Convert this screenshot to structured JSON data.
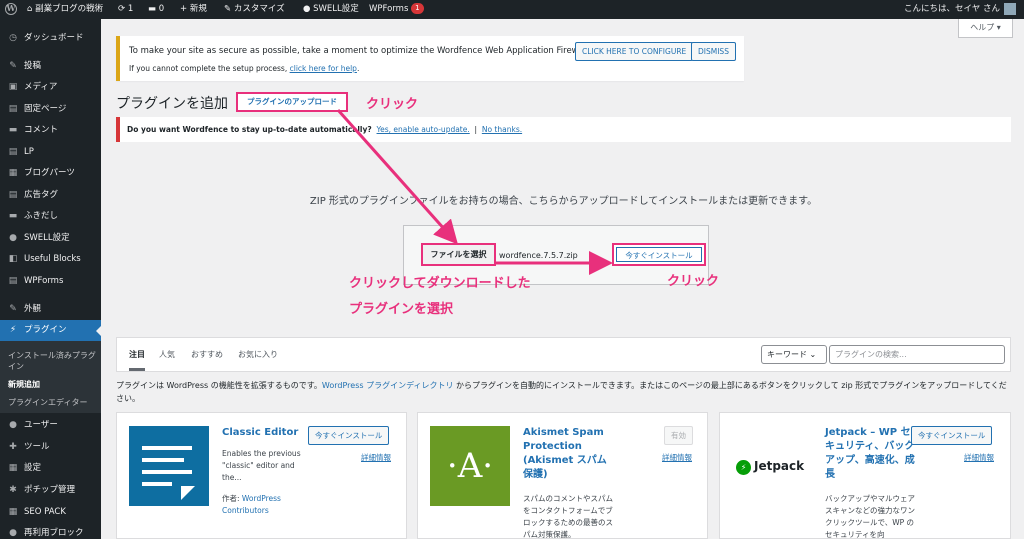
{
  "adminbar": {
    "site": "副業ブログの戦術",
    "updates": "1",
    "comments": "0",
    "new": "新規",
    "customize": "カスタマイズ",
    "swell": "SWELL設定",
    "wpforms": "WPForms",
    "wpforms_badge": "1",
    "howdy": "こんにちは、セイヤ さん"
  },
  "help_label": "ヘルプ ▾",
  "sidebar": {
    "items": [
      {
        "label": "ダッシュボード",
        "icon": "dashboard-icon",
        "glyph": "◷"
      },
      {
        "label": "投稿",
        "icon": "pin-icon",
        "glyph": "✎"
      },
      {
        "label": "メディア",
        "icon": "media-icon",
        "glyph": "▣"
      },
      {
        "label": "固定ページ",
        "icon": "page-icon",
        "glyph": "▤"
      },
      {
        "label": "コメント",
        "icon": "comment-icon",
        "glyph": "▬"
      },
      {
        "label": "LP",
        "icon": "lp-icon",
        "glyph": "▤"
      },
      {
        "label": "ブログパーツ",
        "icon": "parts-icon",
        "glyph": "▦"
      },
      {
        "label": "広告タグ",
        "icon": "ad-icon",
        "glyph": "▤"
      },
      {
        "label": "ふきだし",
        "icon": "balloon-icon",
        "glyph": "▬"
      },
      {
        "label": "SWELL設定",
        "icon": "swell-icon",
        "glyph": "●"
      },
      {
        "label": "Useful Blocks",
        "icon": "blocks-icon",
        "glyph": "◧"
      },
      {
        "label": "WPForms",
        "icon": "forms-icon",
        "glyph": "▤"
      },
      {
        "label": "外観",
        "icon": "brush-icon",
        "glyph": "✎"
      },
      {
        "label": "プラグイン",
        "icon": "plugin-icon",
        "glyph": "⚡"
      },
      {
        "label": "ユーザー",
        "icon": "user-icon",
        "glyph": "●"
      },
      {
        "label": "ツール",
        "icon": "tool-icon",
        "glyph": "✚"
      },
      {
        "label": "設定",
        "icon": "settings-icon",
        "glyph": "▦"
      },
      {
        "label": "ポチップ管理",
        "icon": "gear-icon",
        "glyph": "✱"
      },
      {
        "label": "SEO PACK",
        "icon": "seo-icon",
        "glyph": "▦"
      },
      {
        "label": "再利用ブロック",
        "icon": "reuse-icon",
        "glyph": "●"
      }
    ],
    "sub": [
      "インストール済みプラグイン",
      "新規追加",
      "プラグインエディター"
    ]
  },
  "notice": {
    "text": "To make your site as secure as possible, take a moment to optimize the Wordfence Web Application Firewall:",
    "configure": "CLICK HERE TO CONFIGURE",
    "dismiss": "DISMISS",
    "sub_text": "If you cannot complete the setup process,",
    "sub_link": "click here for help",
    "period": "."
  },
  "page": {
    "title": "プラグインを追加",
    "upload_btn": "プラグインのアップロード"
  },
  "annotations": {
    "click1": "クリック",
    "select_line1": "クリックしてダウンロードした",
    "select_line2": "プラグインを選択",
    "click2": "クリック",
    "color": "#e8307c"
  },
  "wf_notice": {
    "question": "Do you want Wordfence to stay up-to-date automatically?",
    "yes": "Yes, enable auto-update.",
    "sep": "|",
    "no": "No thanks."
  },
  "upload": {
    "text": "ZIP 形式のプラグインファイルをお持ちの場合、こちらからアップロードしてインストールまたは更新できます。",
    "file_btn": "ファイルを選択",
    "filename": "wordfence.7.5.7.zip",
    "install_btn": "今すぐインストール"
  },
  "tabs": [
    "注目",
    "人気",
    "おすすめ",
    "お気に入り"
  ],
  "search": {
    "type": "キーワード",
    "placeholder": "プラグインの検索..."
  },
  "description": {
    "part1": "プラグインは WordPress の機能性を拡張するものです。",
    "link": "WordPress プラグインディレクトリ",
    "part2": " からプラグインを自動的にインストールできます。またはこのページの最上部にあるボタンをクリックして zip 形式でプラグインをアップロードしてください。"
  },
  "cards": [
    {
      "name": "Classic Editor",
      "button": "今すぐインストール",
      "details": "詳細情報",
      "desc": "Enables the previous \"classic\" editor and the...",
      "author_prefix": "作者: ",
      "author": "WordPress Contributors",
      "thumb_color": "#0e6ea1"
    },
    {
      "name": "Akismet Spam Protection (Akismet スパム保護)",
      "button": "有効",
      "details": "詳細情報",
      "desc": "スパムのコメントやスパムをコンタクトフォームでブロックするための最善のスパム対策保護。",
      "thumb_letter": "·A·",
      "thumb_color": "#6a9a24"
    },
    {
      "name": "Jetpack – WP セキュリティ、バックアップ、高速化、成長",
      "button": "今すぐインストール",
      "details": "詳細情報",
      "desc": "バックアップやマルウェアスキャンなどの強力なワンクリックツールで、WP のセキュリティを向",
      "thumb_text": "Jetpack",
      "thumb_color": "#069e08"
    }
  ]
}
